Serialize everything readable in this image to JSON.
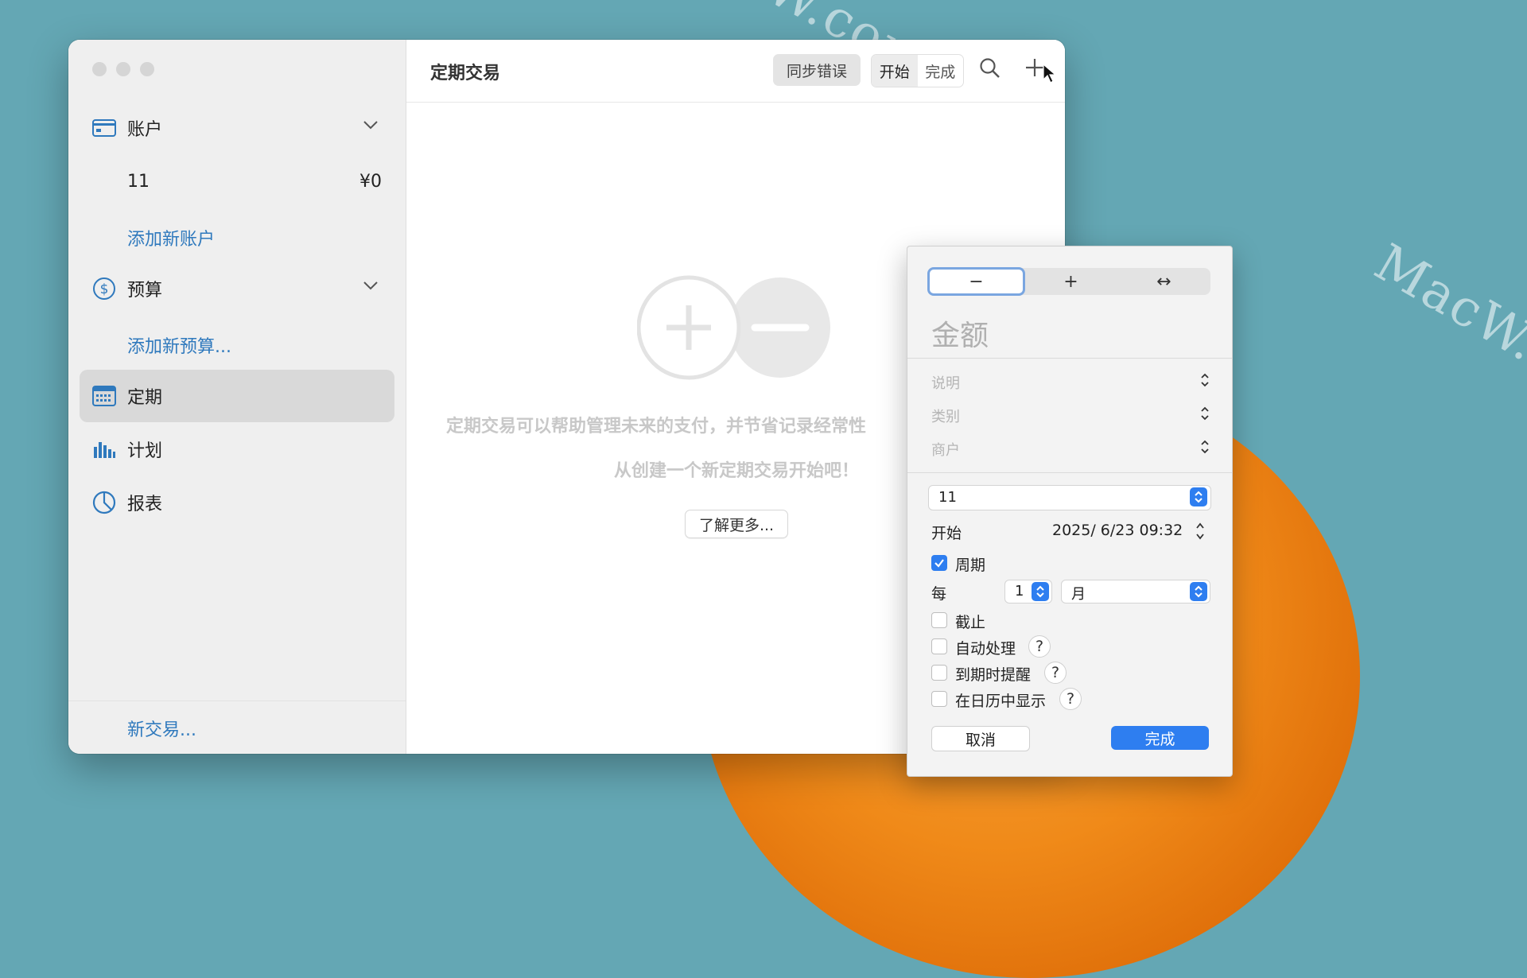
{
  "background": {
    "watermark": "MacW.com"
  },
  "sidebar": {
    "accounts_label": "账户",
    "account_name": "11",
    "account_balance": "¥0",
    "add_account": "添加新账户",
    "budget_label": "预算",
    "add_budget": "添加新预算...",
    "recurring_label": "定期",
    "planning_label": "计划",
    "reports_label": "报表",
    "new_transaction": "新交易..."
  },
  "toolbar": {
    "title": "定期交易",
    "sync_error": "同步错误",
    "segment_start": "开始",
    "segment_done": "完成"
  },
  "empty_state": {
    "line1": "定期交易可以帮助管理未来的支付，并节省记录经常性",
    "line2": "从创建一个新定期交易开始吧！",
    "learn_more": "了解更多..."
  },
  "popover": {
    "seg_minus": "−",
    "seg_plus": "+",
    "seg_transfer": "↔",
    "amount_placeholder": "金额",
    "description_placeholder": "说明",
    "category_placeholder": "类别",
    "payee_placeholder": "商户",
    "account_value": "11",
    "start_label": "开始",
    "start_value": "2025/  6/23 09:32",
    "periodic_label": "周期",
    "periodic_checked": true,
    "every_label": "每",
    "every_count": "1",
    "every_unit": "月",
    "end_label": "截止",
    "auto_process_label": "自动处理",
    "remind_label": "到期时提醒",
    "calendar_label": "在日历中显示",
    "help_symbol": "?",
    "cancel": "取消",
    "done": "完成"
  },
  "colors": {
    "accent": "#2e7ef0",
    "link": "#2f79bd",
    "background": "#64a7b4",
    "sidebar_selected": "#d9d9d9"
  },
  "icons": {
    "accounts": "credit-card-icon",
    "budget": "dollar-circle-icon",
    "recurring": "calendar-icon",
    "planning": "bar-chart-icon",
    "reports": "pie-chart-icon"
  }
}
